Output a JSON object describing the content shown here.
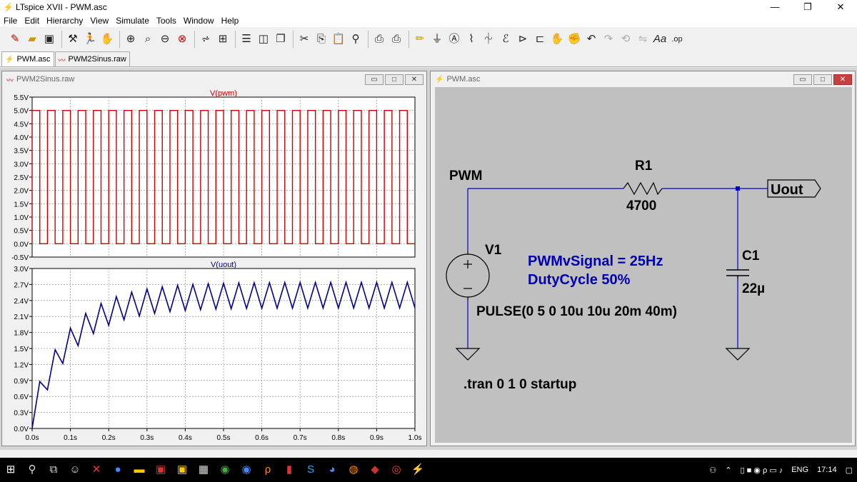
{
  "window": {
    "title": "LTspice XVII - PWM.asc",
    "minimize": "—",
    "restore": "❐",
    "close": "✕"
  },
  "menu": [
    "File",
    "Edit",
    "Hierarchy",
    "View",
    "Simulate",
    "Tools",
    "Window",
    "Help"
  ],
  "toolbar_icons": [
    "new-schematic-icon",
    "open-icon",
    "save-icon",
    "control-panel-icon",
    "run-icon",
    "halt-icon",
    "zoom-in-icon",
    "zoom-out-icon",
    "zoom-full-icon",
    "autoscale-icon",
    "fit-icon",
    "tile-horizontal-icon",
    "tile-vertical-icon",
    "cascade-icon",
    "cut-icon",
    "copy-icon",
    "paste-icon",
    "find-icon",
    "print-icon",
    "print-preview-icon",
    "wire-icon",
    "ground-icon",
    "label-icon",
    "resistor-icon",
    "capacitor-icon",
    "inductor-icon",
    "diode-icon",
    "component-icon",
    "move-icon",
    "drag-icon",
    "undo-icon",
    "redo-icon",
    "rotate-icon",
    "mirror-icon",
    "text-icon",
    "spice-directive-icon"
  ],
  "tabs": [
    {
      "label": "PWM.asc",
      "active": true
    },
    {
      "label": "PWM2Sinus.raw",
      "active": false
    }
  ],
  "plot_window": {
    "title": "PWM2Sinus.raw",
    "btn_min": "▭",
    "btn_max": "□",
    "btn_close": "✕"
  },
  "schematic_window": {
    "title": "PWM.asc",
    "btn_min": "▭",
    "btn_max": "□",
    "btn_close": "✕"
  },
  "chart_data": [
    {
      "type": "line",
      "title": "V(pwm)",
      "series_color": "#cc0000",
      "ylim": [
        -0.5,
        5.5
      ],
      "yticks": [
        "5.5V",
        "5.0V",
        "4.5V",
        "4.0V",
        "3.5V",
        "3.0V",
        "2.5V",
        "2.0V",
        "1.5V",
        "1.0V",
        "0.5V",
        "0.0V",
        "-0.5V"
      ],
      "xlim": [
        0,
        1.0
      ],
      "period_s": 0.04,
      "duty": 0.5,
      "high_v": 5.0,
      "low_v": 0.0,
      "grid": true
    },
    {
      "type": "line",
      "title": "V(uout)",
      "series_color": "#00008b",
      "ylim": [
        0.0,
        3.0
      ],
      "yticks": [
        "3.0V",
        "2.7V",
        "2.4V",
        "2.1V",
        "1.8V",
        "1.5V",
        "1.2V",
        "0.9V",
        "0.6V",
        "0.3V",
        "0.0V"
      ],
      "xticks": [
        "0.0s",
        "0.1s",
        "0.2s",
        "0.3s",
        "0.4s",
        "0.5s",
        "0.6s",
        "0.7s",
        "0.8s",
        "0.9s",
        "1.0s"
      ],
      "xlim": [
        0,
        1.0
      ],
      "tau_s": 0.1034,
      "source_v": 5.0,
      "period_s": 0.04,
      "grid": true
    }
  ],
  "schematic": {
    "net_pwm": "PWM",
    "r_name": "R1",
    "r_value": "4700",
    "v_name": "V1",
    "c_name": "C1",
    "c_value": "22µ",
    "out_label": "Uout",
    "comment_line1": "PWMvSignal = 25Hz",
    "comment_line2": "DutyCycle 50%",
    "pulse": "PULSE(0 5 0 10u 10u 20m 40m)",
    "tran": ".tran 0 1 0 startup",
    "comment_color": "#0000b0",
    "wire_color": "#0000cc"
  },
  "taskbar": {
    "lang": "ENG",
    "time": "17:14"
  }
}
